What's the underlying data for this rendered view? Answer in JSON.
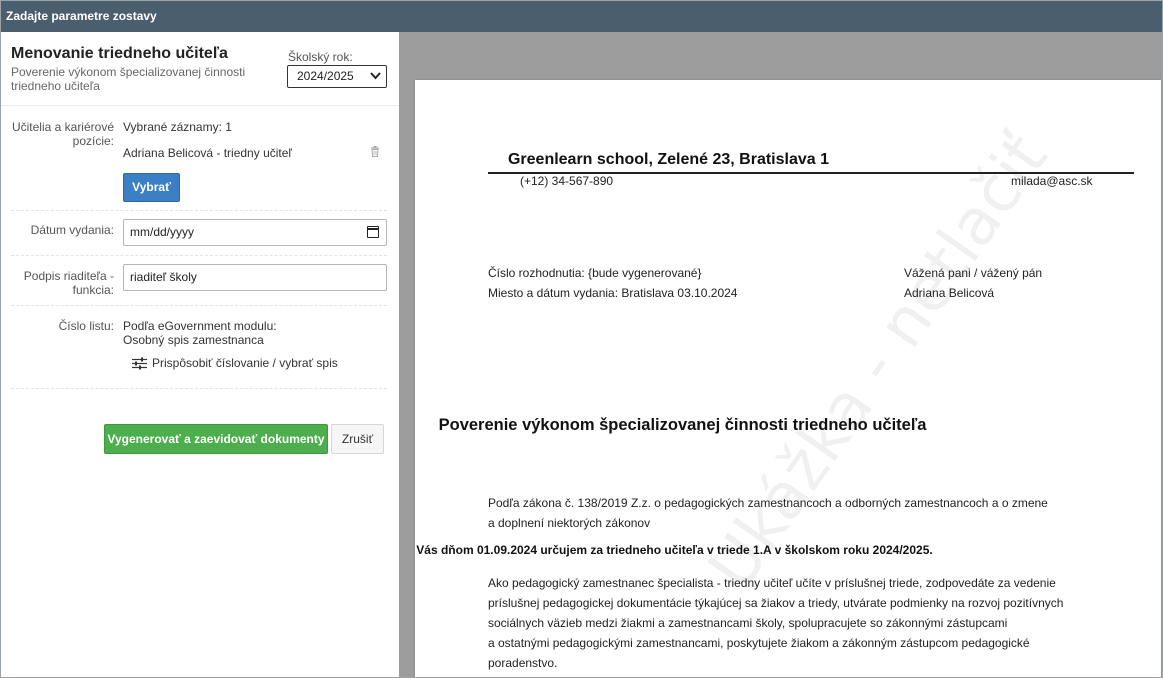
{
  "window": {
    "title": "Zadajte parametre zostavy"
  },
  "form": {
    "title": "Menovanie triedneho učiteľa",
    "subtitle": "Poverenie výkonom špecializovanej činnosti triedneho učiteľa",
    "school_year_label": "Školský rok:",
    "school_year_value": "2024/2025",
    "teachers_label": "Učitelia a kariérové pozície:",
    "selected_records": "Vybrané záznamy: 1",
    "selected_teacher": "Adriana Belicová - triedny učiteľ",
    "select_button": "Vybrať",
    "date_label": "Dátum vydania:",
    "date_placeholder": "mm/dd/yyyy",
    "signature_label": "Podpis riaditeľa - funkcia:",
    "signature_value": "riaditeľ školy",
    "sheet_number_label": "Číslo listu:",
    "sheet_number_line1": "Podľa eGovernment modulu:",
    "sheet_number_line2": "Osobný spis zamestnanca",
    "customize_link": "Prispôsobiť číslovanie / vybrať spis",
    "generate_button": "Vygenerovať a zaevidovať dokumenty",
    "cancel_button": "Zrušiť"
  },
  "preview": {
    "school_header": "Greenlearn school, Zelené 23, Bratislava 1",
    "phone": "(+12) 34-567-890",
    "email": "milada@asc.sk",
    "decision_number": "Číslo rozhodnutia: {bude vygenerované}",
    "place_date": "Miesto a dátum vydania: Bratislava 03.10.2024",
    "salutation": "Vážená pani / vážený pán",
    "recipient": "Adriana Belicová",
    "doc_title": "Poverenie výkonom špecializovanej činnosti triedneho učiteľa",
    "law_line1": "Podľa zákona č. 138/2019 Z.z. o pedagogických zamestnancoch a odborných zamestnancoch a o zmene",
    "law_line2": "a doplnení niektorých zákonov",
    "appointment": "Vás dňom 01.09.2024 určujem za triedneho učiteľa v triede 1.A v školskom roku 2024/2025.",
    "body_line1": "Ako pedagogický zamestnanec špecialista - triedny učiteľ učíte v príslušnej triede, zodpovedáte za vedenie",
    "body_line2": "príslušnej pedagogickej dokumentácie týkajúcej sa žiakov a triedy, utvárate podmienky na rozvoj pozitívnych",
    "body_line3": "sociálnych väzieb medzi žiakmi a zamestnancami školy, spolupracujete so zákonnými zástupcami",
    "body_line4": "a ostatnými pedagogickými zamestnancami, poskytujete žiakom a zákonným zástupcom pedagogické",
    "body_line5": "poradenstvo.",
    "watermark": "Ukážka - netlačiť"
  }
}
